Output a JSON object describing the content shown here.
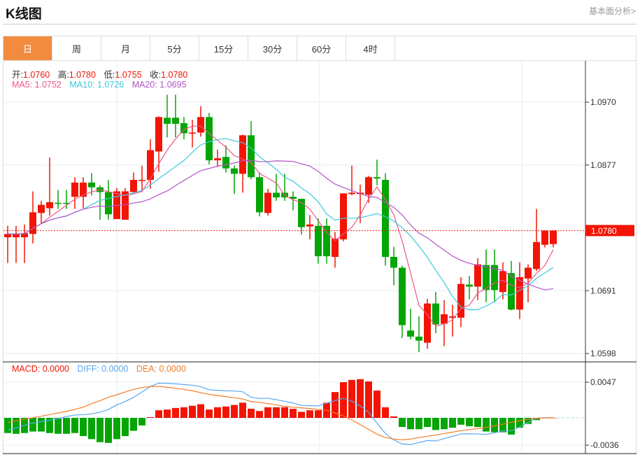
{
  "header": {
    "title": "K线图",
    "link": "基本面分析>"
  },
  "tabs": [
    {
      "label": "日",
      "active": true
    },
    {
      "label": "周"
    },
    {
      "label": "月"
    },
    {
      "label": "5分"
    },
    {
      "label": "15分"
    },
    {
      "label": "30分"
    },
    {
      "label": "60分"
    },
    {
      "label": "4时"
    }
  ],
  "ohlc": {
    "open_label": "开:",
    "open": "1.0760",
    "high_label": "高:",
    "high": "1.0780",
    "low_label": "低:",
    "low": "1.0755",
    "close_label": "收:",
    "close": "1.0780"
  },
  "ma": {
    "ma5": "MA5: 1.0752",
    "ma10": "MA10: 1.0726",
    "ma20": "MA20: 1.0695"
  },
  "macd_legend": {
    "macd": "MACD: 0.0000",
    "diff": "DIFF: 0.0000",
    "dea": "DEA: 0.0000"
  },
  "colors": {
    "up": "#f21505",
    "down": "#04a505",
    "accent": "#f38b3f",
    "ma5": "#f0548a",
    "ma10": "#3cc8dc",
    "ma20": "#b255c8",
    "diff": "#5aa8ef",
    "dea": "#f57c24"
  },
  "chart_data": {
    "type": "candlestick",
    "price_axis": {
      "ticks": [
        "1.0970",
        "1.0877",
        "1.0691",
        "1.0598"
      ],
      "range": [
        1.0598,
        1.097
      ]
    },
    "last_price_label": "1.0780",
    "candles": [
      [
        1.077,
        1.0787,
        1.0732,
        1.0775
      ],
      [
        1.077,
        1.0787,
        1.0732,
        1.0775
      ],
      [
        1.077,
        1.0789,
        1.0732,
        1.0776
      ],
      [
        1.0775,
        1.0838,
        1.0761,
        1.0807
      ],
      [
        1.0806,
        1.0824,
        1.079,
        1.0818
      ],
      [
        1.0813,
        1.0888,
        1.0802,
        1.0822
      ],
      [
        1.0821,
        1.084,
        1.0812,
        1.082
      ],
      [
        1.0821,
        1.084,
        1.0812,
        1.082
      ],
      [
        1.083,
        1.0859,
        1.0812,
        1.0851
      ],
      [
        1.083,
        1.0859,
        1.0813,
        1.0851
      ],
      [
        1.0851,
        1.0865,
        1.0832,
        1.0844
      ],
      [
        1.0844,
        1.0847,
        1.0796,
        1.0837
      ],
      [
        1.0837,
        1.0855,
        1.0796,
        1.0804
      ],
      [
        1.0797,
        1.0843,
        1.0797,
        1.0838
      ],
      [
        1.0796,
        1.0843,
        1.0796,
        1.0838
      ],
      [
        1.0837,
        1.0866,
        1.0837,
        1.0855
      ],
      [
        1.0854,
        1.0876,
        1.0837,
        1.0855
      ],
      [
        1.0855,
        1.0915,
        1.0842,
        1.0899
      ],
      [
        1.0897,
        1.0949,
        1.0867,
        1.0948
      ],
      [
        1.0947,
        1.0981,
        1.0918,
        1.0938
      ],
      [
        1.0947,
        1.0981,
        1.0918,
        1.0938
      ],
      [
        1.0939,
        1.0948,
        1.0915,
        1.0924
      ],
      [
        1.0924,
        1.0944,
        1.0903,
        1.0925
      ],
      [
        1.0925,
        1.0964,
        1.0919,
        1.0948
      ],
      [
        1.0948,
        1.0954,
        1.0878,
        1.0884
      ],
      [
        1.0884,
        1.09,
        1.0874,
        1.0887
      ],
      [
        1.0889,
        1.0906,
        1.0866,
        1.0872
      ],
      [
        1.0872,
        1.0876,
        1.0834,
        1.0864
      ],
      [
        1.0864,
        1.0922,
        1.0836,
        1.0921
      ],
      [
        1.0921,
        1.0942,
        1.0856,
        1.0859
      ],
      [
        1.0859,
        1.0866,
        1.0801,
        1.0807
      ],
      [
        1.0806,
        1.0842,
        1.0802,
        1.0836
      ],
      [
        1.0836,
        1.0864,
        1.0824,
        1.0829
      ],
      [
        1.0836,
        1.0864,
        1.0824,
        1.0829
      ],
      [
        1.083,
        1.0838,
        1.081,
        1.0827
      ],
      [
        1.0827,
        1.0827,
        1.0774,
        1.0785
      ],
      [
        1.0786,
        1.0803,
        1.0767,
        1.0789
      ],
      [
        1.0787,
        1.0798,
        1.0731,
        1.0742
      ],
      [
        1.0787,
        1.0798,
        1.0731,
        1.0742
      ],
      [
        1.0741,
        1.0778,
        1.0725,
        1.0768
      ],
      [
        1.0767,
        1.0835,
        1.0764,
        1.0835
      ],
      [
        1.0834,
        1.0876,
        1.0832,
        1.0836
      ],
      [
        1.0834,
        1.0848,
        1.0791,
        1.0836
      ],
      [
        1.0833,
        1.0861,
        1.0821,
        1.0859
      ],
      [
        1.0859,
        1.0885,
        1.0847,
        1.0857
      ],
      [
        1.0855,
        1.0865,
        1.0728,
        1.0741
      ],
      [
        1.0741,
        1.0756,
        1.0699,
        1.0725
      ],
      [
        1.0725,
        1.0728,
        1.0621,
        1.064
      ],
      [
        1.0632,
        1.0664,
        1.0619,
        1.0623
      ],
      [
        1.0623,
        1.0653,
        1.06,
        1.0617
      ],
      [
        1.0614,
        1.0679,
        1.0605,
        1.0672
      ],
      [
        1.0672,
        1.0689,
        1.0628,
        1.0641
      ],
      [
        1.0642,
        1.0677,
        1.0609,
        1.0656
      ],
      [
        1.0651,
        1.067,
        1.0623,
        1.0653
      ],
      [
        1.0651,
        1.0711,
        1.0637,
        1.0701
      ],
      [
        1.07,
        1.0713,
        1.0678,
        1.0697
      ],
      [
        1.0697,
        1.0739,
        1.0677,
        1.073
      ],
      [
        1.0729,
        1.0752,
        1.0674,
        1.0692
      ],
      [
        1.0729,
        1.0752,
        1.0674,
        1.0692
      ],
      [
        1.0689,
        1.0733,
        1.0678,
        1.072
      ],
      [
        1.0717,
        1.0735,
        1.0662,
        1.0663
      ],
      [
        1.0663,
        1.0733,
        1.0649,
        1.0711
      ],
      [
        1.0709,
        1.073,
        1.0674,
        1.0725
      ],
      [
        1.0723,
        1.0812,
        1.072,
        1.0763
      ],
      [
        1.0759,
        1.078,
        1.0755,
        1.078
      ],
      [
        1.076,
        1.078,
        1.0755,
        1.078
      ]
    ],
    "macd_axis": {
      "ticks": [
        "0.0047",
        "-0.0036"
      ],
      "range": [
        -0.0036,
        0.0047
      ]
    },
    "macd_hist": [
      -20,
      -21,
      -20,
      -18,
      -18,
      -20,
      -21,
      -21,
      -20,
      -24,
      -28,
      -32,
      -33,
      -28,
      -24,
      -17,
      -10,
      1,
      10,
      11,
      13,
      14,
      16,
      18,
      11,
      14,
      15,
      17,
      20,
      12,
      9,
      14,
      14,
      14,
      12,
      8,
      10,
      10,
      20,
      34,
      47,
      50,
      51,
      48,
      36,
      14,
      2,
      -12,
      -15,
      -15,
      -12,
      -16,
      -15,
      -13,
      -9,
      -11,
      -12,
      -18,
      -19,
      -19,
      -22,
      -13,
      -8,
      -3,
      0,
      0
    ],
    "diff": [
      -16.0,
      -13.5,
      -9.8,
      -6.8,
      -4.9,
      -3.1,
      -1.2,
      1.8,
      3.7,
      4.3,
      5.2,
      7.4,
      11.1,
      17.2,
      21.5,
      27.1,
      34.1,
      41.2,
      45.8,
      45.5,
      44.9,
      43.9,
      43.0,
      41.2,
      36.9,
      36.3,
      35.7,
      35.4,
      34.4,
      27.1,
      25.5,
      25.8,
      24.0,
      21.8,
      19.7,
      16.3,
      16.0,
      15.7,
      19.4,
      22.7,
      25.8,
      21.8,
      15.7,
      7.4,
      -6.8,
      -20.6,
      -28.9,
      -34.4,
      -35.0,
      -32.6,
      -29.8,
      -30.4,
      -27.4,
      -24.3,
      -21.2,
      -20.9,
      -21.2,
      -21.8,
      -19.7,
      -17.2,
      -16.6,
      -12.0,
      -5.8,
      -0.6,
      0.3,
      0.3
    ],
    "dea": [
      -6.1,
      -4.0,
      -1.8,
      0,
      2.2,
      4.3,
      6.5,
      8.6,
      11.1,
      14.1,
      18.8,
      22.7,
      27.1,
      30.4,
      34.1,
      37.5,
      40.0,
      41.2,
      41.5,
      40.3,
      39.0,
      37.5,
      35.7,
      33.2,
      31.0,
      29.5,
      28.0,
      26.4,
      24.9,
      21.5,
      20.3,
      18.8,
      17.2,
      15.1,
      14.1,
      13.2,
      12.3,
      11.1,
      9.8,
      6.5,
      2.5,
      -2.8,
      -8.9,
      -15.1,
      -21.5,
      -25.8,
      -28.0,
      -28.9,
      -28.0,
      -25.8,
      -24.3,
      -22.7,
      -20.6,
      -18.8,
      -16.9,
      -15.4,
      -14.1,
      -12.6,
      -10.5,
      -8.3,
      -5.8,
      -3.7,
      -1.8,
      -0.6,
      0,
      0.3
    ],
    "macd_unit": 0.0001
  }
}
